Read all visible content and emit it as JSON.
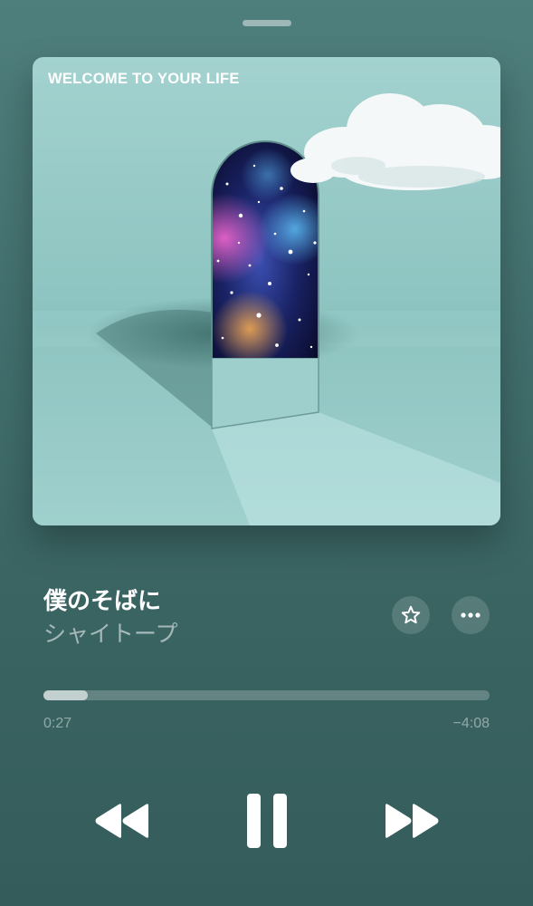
{
  "album": {
    "label": "WELCOME TO YOUR LIFE"
  },
  "track": {
    "title": "僕のそばに",
    "artist": "シャイトープ"
  },
  "playback": {
    "elapsed": "0:27",
    "remaining": "−4:08",
    "progress": 0.099
  },
  "controls": {
    "favorite_icon": "star-icon",
    "more_icon": "ellipsis-icon",
    "rewind_icon": "rewind-icon",
    "pause_icon": "pause-icon",
    "forward_icon": "fast-forward-icon"
  },
  "colors": {
    "background": "#42706e",
    "art_background": "#8fc5c3"
  }
}
